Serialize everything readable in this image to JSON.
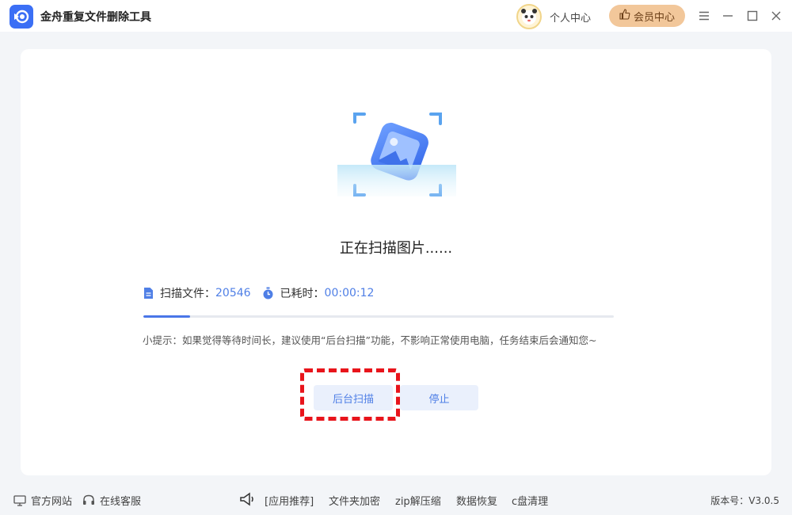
{
  "app": {
    "title": "金舟重复文件删除工具"
  },
  "header": {
    "personal_center": "个人中心",
    "vip_center": "会员中心"
  },
  "scan": {
    "status": "正在扫描图片......",
    "files_label": "扫描文件：",
    "files_count": "20546",
    "time_label": "已耗时：",
    "elapsed": "00:00:12",
    "progress": 0.1,
    "tip": "小提示：如果觉得等待时间长，建议使用“后台扫描”功能，不影响正常使用电脑，任务结束后会通知您~",
    "background_button": "后台扫描",
    "stop_button": "停止"
  },
  "footer": {
    "official_site": "官方网站",
    "online_service": "在线客服",
    "recommend": "[应用推荐]",
    "links": [
      "文件夹加密",
      "zip解压缩",
      "数据恢复",
      "c盘清理"
    ],
    "version": "版本号：V3.0.5"
  },
  "colors": {
    "accent": "#4f7fe6",
    "highlight": "#e8141b",
    "vip": "#f2c79a"
  }
}
